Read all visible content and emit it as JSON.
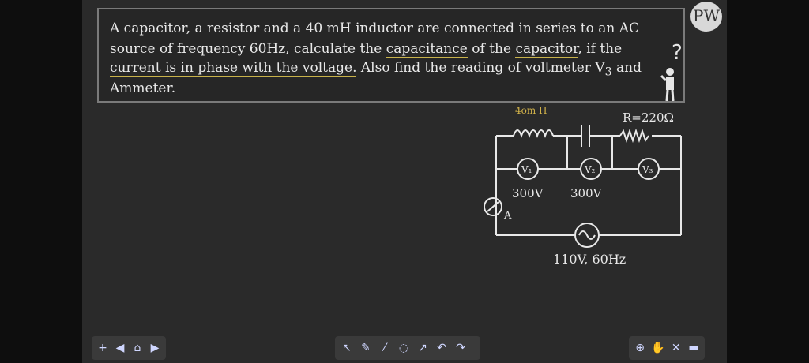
{
  "question": {
    "line1": "A capacitor, a resistor and a 40 mH inductor are connected in series to an AC",
    "line2_a": "source of frequency 60Hz, calculate the ",
    "line2_b": "capacitance",
    "line2_c": " of the ",
    "line2_d": "capacitor",
    "line2_e": ", if the",
    "line3_a": "current is in phase with the voltage.",
    "line3_b": " Also find the reading of voltmeter V",
    "line3_sub": "3",
    "line3_c": " and",
    "line4": "Ammeter."
  },
  "logo": {
    "text": "PW"
  },
  "qmark": {
    "text": "?"
  },
  "circuit": {
    "inductor_label": "4om H",
    "resistor_label": "R=220Ω",
    "v1": "V₁",
    "v2": "V₂",
    "v3": "V₃",
    "v1_reading": "300V",
    "v2_reading": "300V",
    "ammeter_label": "A",
    "source_label": "110V, 60Hz"
  },
  "toolbar_left": {
    "plus": "+",
    "prev": "◀",
    "page": "⌂",
    "next": "▶"
  },
  "toolbar_mid": {
    "pointer": "↖",
    "pen": "✎",
    "highlighter": "⁄",
    "eraser": "◌",
    "shapes": "↗",
    "undo": "↶",
    "redo": "↷"
  },
  "toolbar_right": {
    "zoom": "⊕",
    "hand": "✋",
    "settings": "✕",
    "screen": "▬"
  }
}
